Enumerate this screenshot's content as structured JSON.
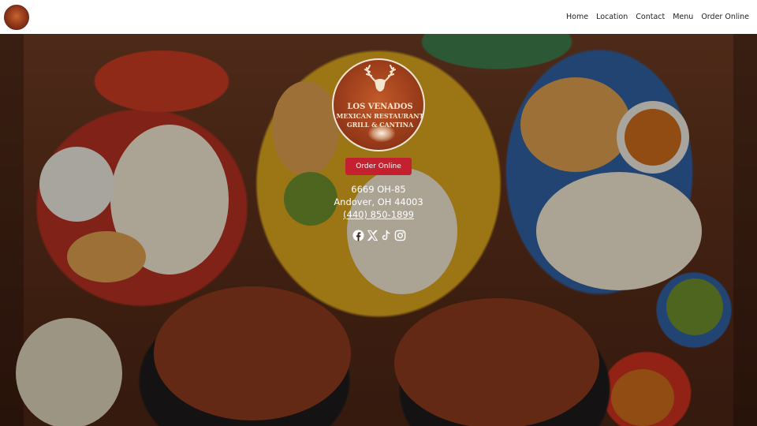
{
  "header": {
    "logo_icon": "los-venados-logo",
    "nav": [
      {
        "label": "Home"
      },
      {
        "label": "Location"
      },
      {
        "label": "Contact"
      },
      {
        "label": "Menu"
      },
      {
        "label": "Order Online"
      }
    ]
  },
  "hero": {
    "logo": {
      "line1": "LOS VENADOS",
      "line2": "MEXICAN RESTAURANT",
      "line3": "GRILL & CANTINA"
    },
    "order_button": "Order Online",
    "address_line1": "6669 OH-85",
    "address_line2": "Andover, OH 44003",
    "phone": "(440) 850-1899",
    "socials": [
      {
        "icon": "facebook-icon"
      },
      {
        "icon": "x-icon"
      },
      {
        "icon": "tiktok-icon"
      },
      {
        "icon": "instagram-icon"
      }
    ]
  },
  "colors": {
    "header_bg": "#ffffff",
    "button_bg": "#c42030",
    "text_on_hero": "#ffffff"
  }
}
